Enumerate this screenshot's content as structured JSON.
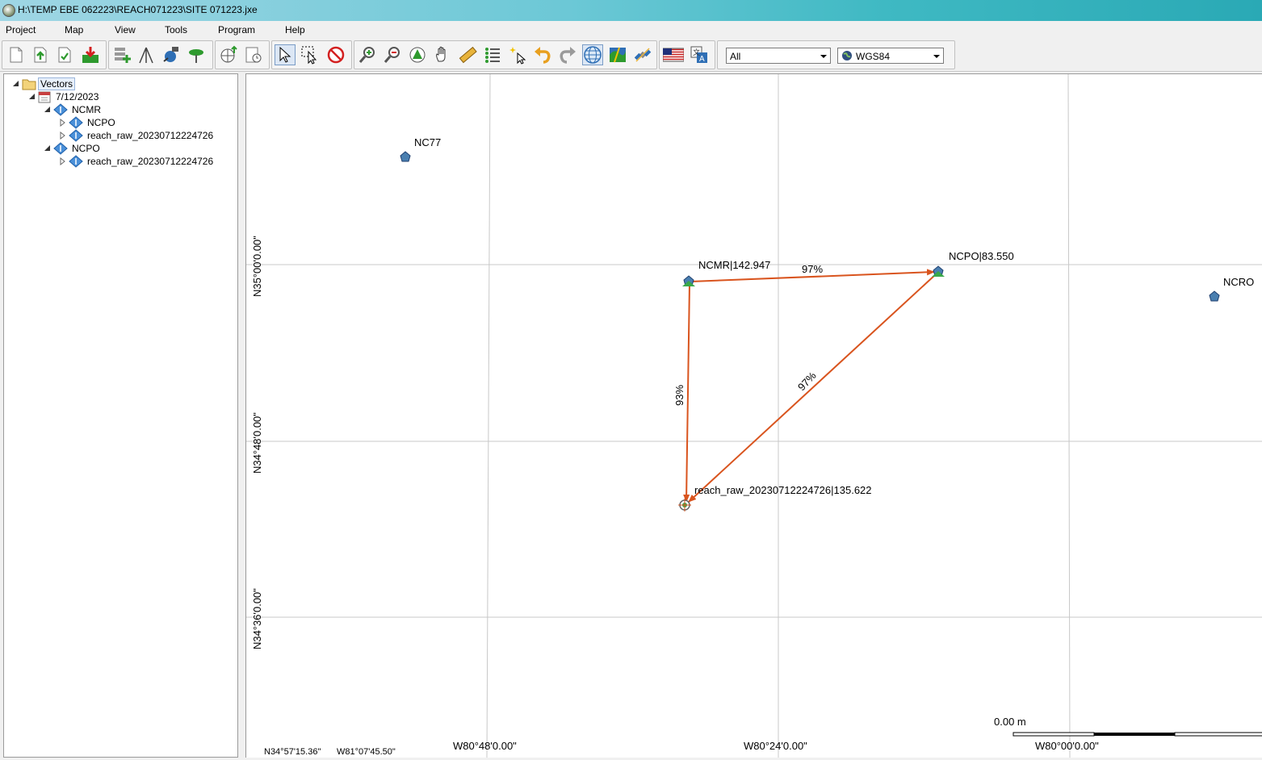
{
  "window": {
    "title": "H:\\TEMP EBE 062223\\REACH071223\\SITE 071223.jxe"
  },
  "menu": [
    "Project",
    "Map",
    "View",
    "Tools",
    "Program",
    "Help"
  ],
  "toolbar": {
    "filter_select": "All",
    "crs_select": "WGS84",
    "colors": {
      "accent": "#2f6fb5",
      "add": "#2e9a2e",
      "delete": "#d32020"
    }
  },
  "tree": {
    "root": "Vectors",
    "date": "7/12/2023",
    "ncmr": "NCMR",
    "ncmr_child1": "NCPO",
    "ncmr_child2": "reach_raw_20230712224726",
    "ncpo": "NCPO",
    "ncpo_child1": "reach_raw_20230712224726"
  },
  "map": {
    "points": {
      "nc77": "NC77",
      "ncro": "NCRO",
      "ncmr": "NCMR|142.947",
      "ncpo": "NCPO|83.550",
      "reach": "reach_raw_20230712224726|135.622"
    },
    "vectors": {
      "ncmr_ncpo": "97%",
      "ncmr_reach": "93%",
      "ncpo_reach": "97%"
    },
    "lat_labels": [
      "N35°00'0.00\"",
      "N34°48'0.00\"",
      "N34°36'0.00\""
    ],
    "lon_labels": [
      "W80°48'0.00\"",
      "W80°24'0.00\"",
      "W80°00'0.00\""
    ],
    "scale_label": "0.00 m",
    "vector_color": "#d9541e"
  },
  "status": {
    "lat": "N34°57'15.36\"",
    "lon": "W81°07'45.50\""
  }
}
